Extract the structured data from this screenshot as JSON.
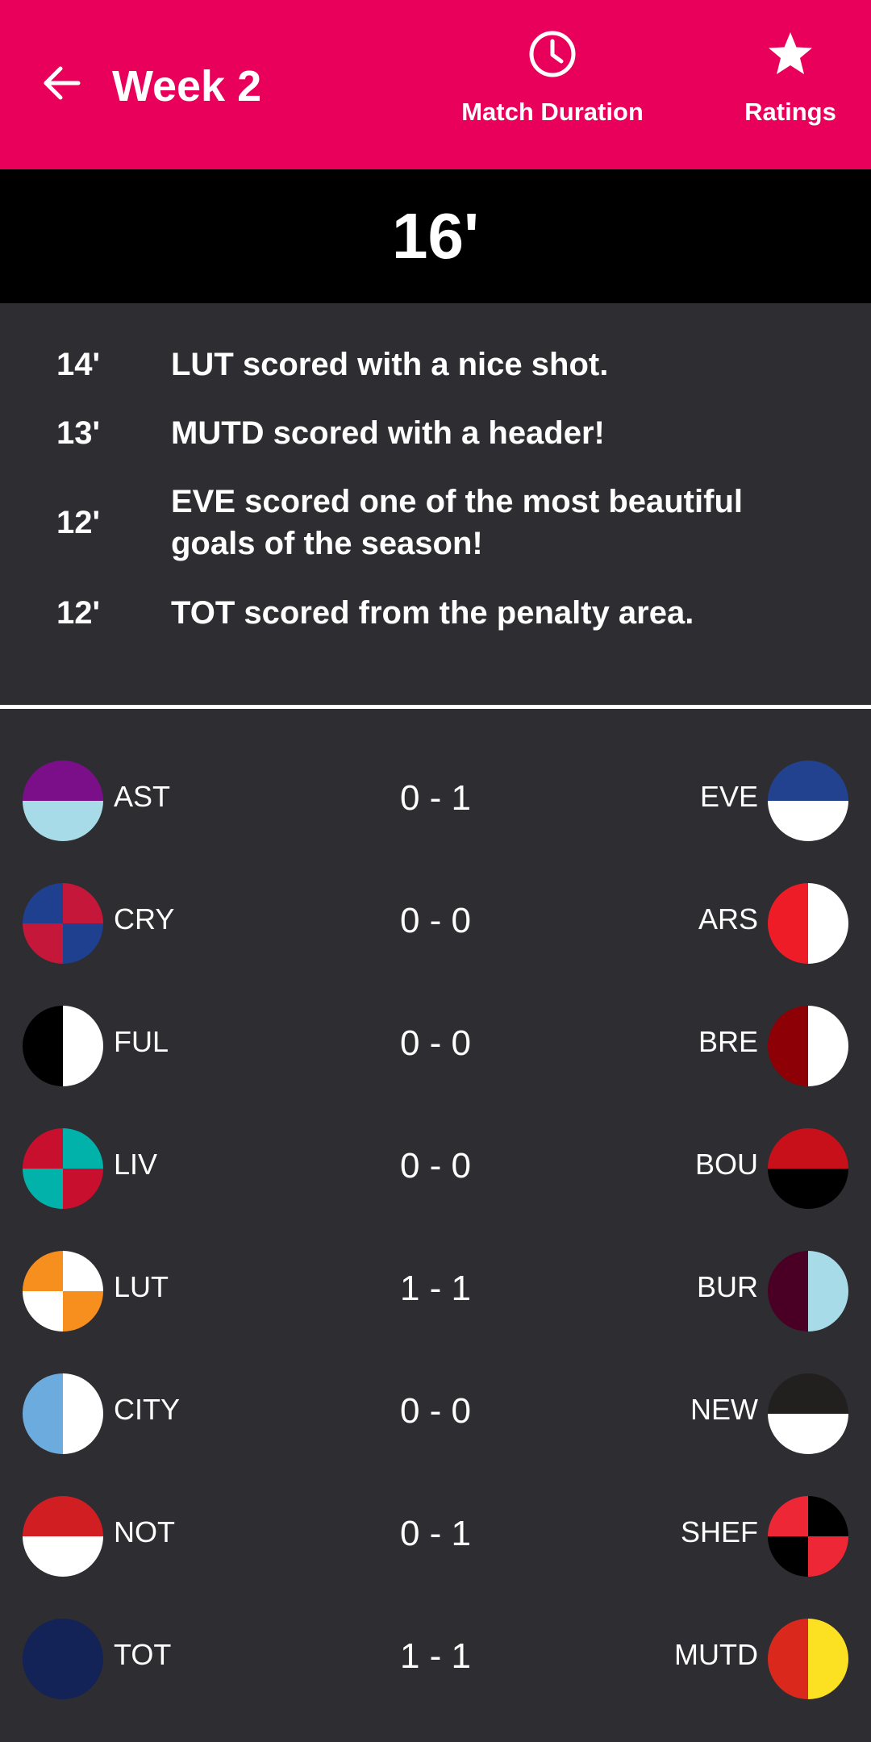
{
  "header": {
    "back_icon": "arrow-left-icon",
    "title": "Week 2",
    "actions": [
      {
        "icon": "clock-icon",
        "label": "Match Duration"
      },
      {
        "icon": "star-icon",
        "label": "Ratings"
      }
    ],
    "colors": {
      "appbar": "#e8005a",
      "background": "#2e2d31",
      "time_bar": "#000000"
    }
  },
  "current_minute": "16'",
  "events": [
    {
      "minute": "14'",
      "text": "LUT scored with a nice shot."
    },
    {
      "minute": "13'",
      "text": "MUTD scored with a header!"
    },
    {
      "minute": "12'",
      "text": "EVE scored one of the most beautiful goals of the season!"
    },
    {
      "minute": "12'",
      "text": "TOT scored from the penalty area."
    }
  ],
  "matches": [
    {
      "home": "AST",
      "score": "0 - 1",
      "away": "EVE",
      "home_crest": {
        "pattern": "top-bottom",
        "colors": [
          "#7b0f8a",
          "#a8dbe8"
        ]
      },
      "away_crest": {
        "pattern": "top-bottom",
        "colors": [
          "#22428f",
          "#ffffff"
        ]
      }
    },
    {
      "home": "CRY",
      "score": "0 - 0",
      "away": "ARS",
      "home_crest": {
        "pattern": "quarters",
        "colors": [
          "#1f3f8f",
          "#c4173a"
        ]
      },
      "away_crest": {
        "pattern": "left-right",
        "colors": [
          "#ee1c26",
          "#ffffff"
        ]
      }
    },
    {
      "home": "FUL",
      "score": "0 - 0",
      "away": "BRE",
      "home_crest": {
        "pattern": "left-right",
        "colors": [
          "#000000",
          "#ffffff"
        ]
      },
      "away_crest": {
        "pattern": "left-right",
        "colors": [
          "#8c0006",
          "#ffffff"
        ]
      }
    },
    {
      "home": "LIV",
      "score": "0 - 0",
      "away": "BOU",
      "home_crest": {
        "pattern": "quarters",
        "colors": [
          "#c8102e",
          "#00b2a9"
        ]
      },
      "away_crest": {
        "pattern": "top-bottom",
        "colors": [
          "#c8101b",
          "#000000"
        ]
      }
    },
    {
      "home": "LUT",
      "score": "1 - 1",
      "away": "BUR",
      "home_crest": {
        "pattern": "quarters",
        "colors": [
          "#f78f1e",
          "#ffffff"
        ]
      },
      "away_crest": {
        "pattern": "left-right",
        "colors": [
          "#4a0025",
          "#a8dbe8"
        ]
      }
    },
    {
      "home": "CITY",
      "score": "0 - 0",
      "away": "NEW",
      "home_crest": {
        "pattern": "left-right",
        "colors": [
          "#6cabdd",
          "#ffffff"
        ]
      },
      "away_crest": {
        "pattern": "top-bottom",
        "colors": [
          "#221f1f",
          "#ffffff"
        ]
      }
    },
    {
      "home": "NOT",
      "score": "0 - 1",
      "away": "SHEF",
      "home_crest": {
        "pattern": "top-bottom",
        "colors": [
          "#d11e23",
          "#ffffff"
        ]
      },
      "away_crest": {
        "pattern": "quarters",
        "colors": [
          "#ee2737",
          "#000000"
        ]
      }
    },
    {
      "home": "TOT",
      "score": "1 - 1",
      "away": "MUTD",
      "home_crest": {
        "pattern": "solid",
        "colors": [
          "#132257",
          "#132257"
        ]
      },
      "away_crest": {
        "pattern": "left-right",
        "colors": [
          "#da291c",
          "#fbe122"
        ]
      }
    }
  ]
}
